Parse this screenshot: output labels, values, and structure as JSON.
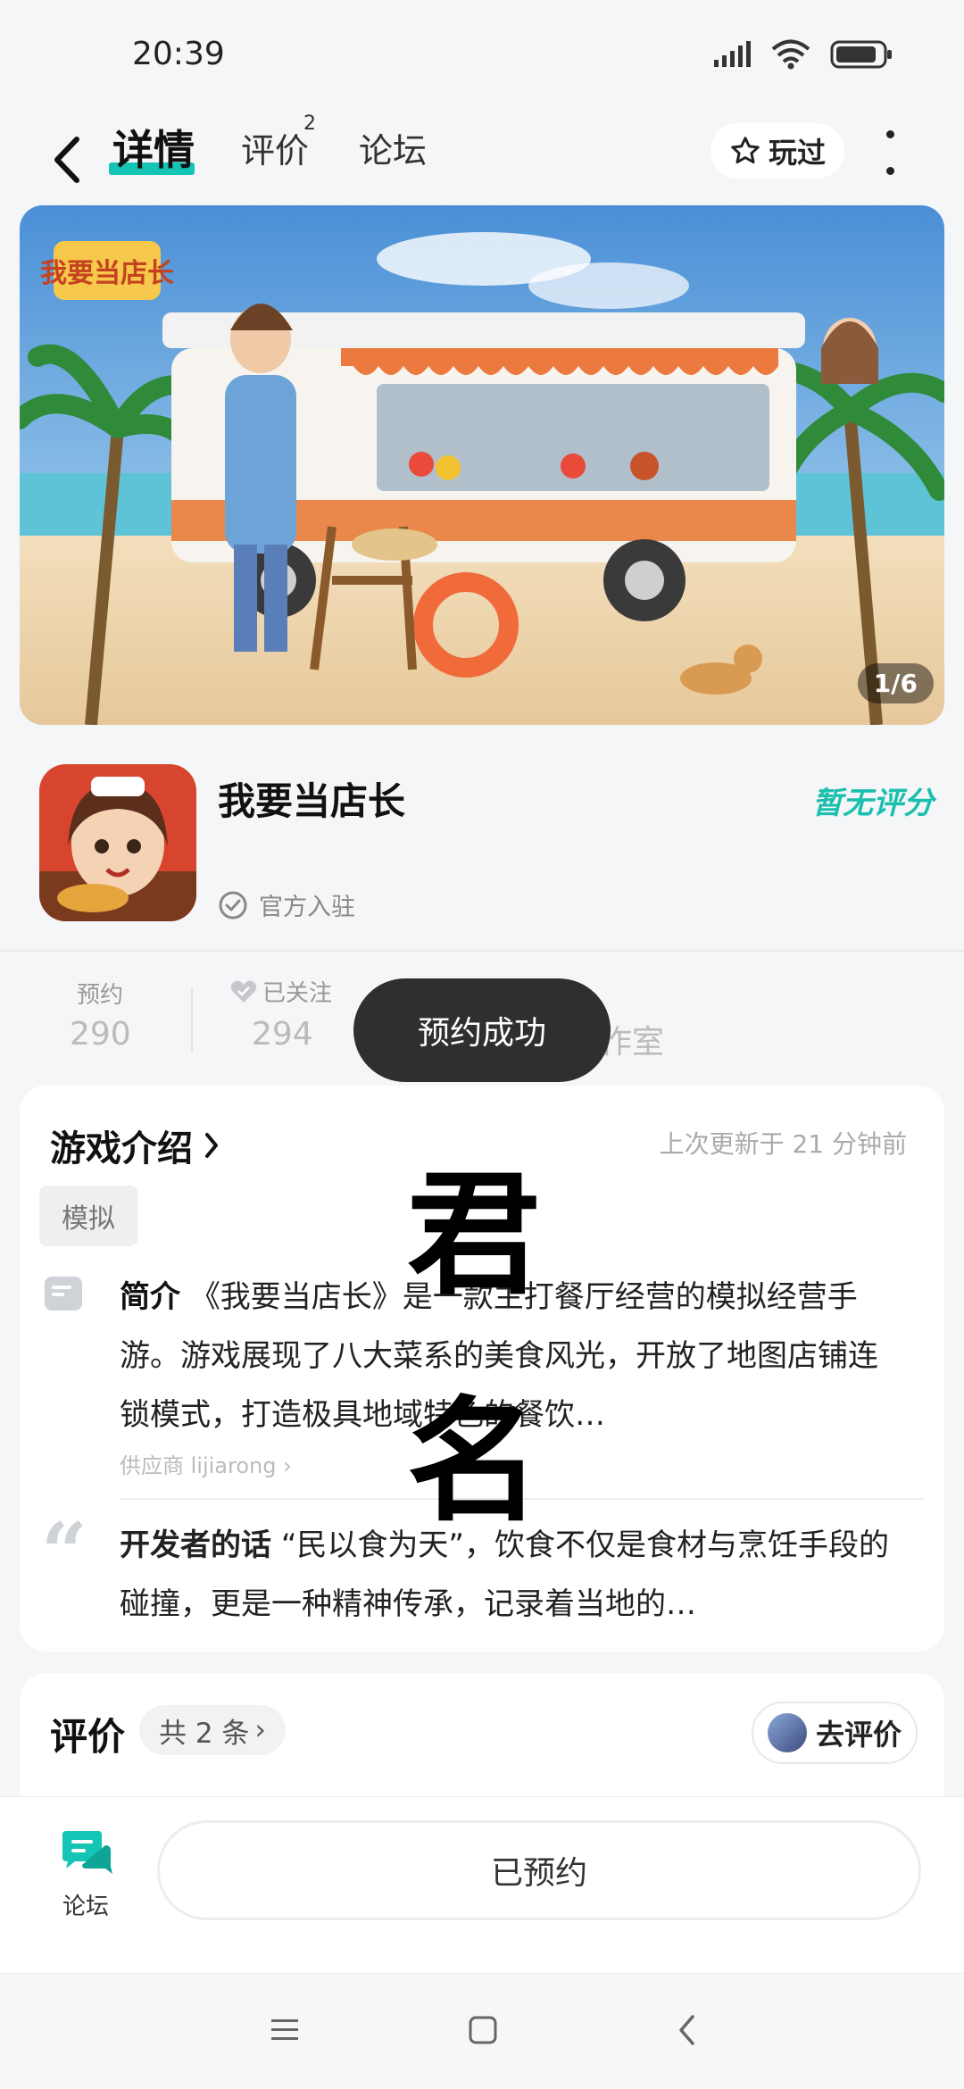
{
  "status": {
    "time": "20:39"
  },
  "nav": {
    "tabs": [
      {
        "label": "详情",
        "active": true
      },
      {
        "label": "评价",
        "badge": "2"
      },
      {
        "label": "论坛"
      }
    ],
    "played_label": "玩过"
  },
  "banner": {
    "counter": "1/6",
    "logo_text": "我要当店长"
  },
  "app": {
    "name": "我要当店长",
    "official_label": "官方入驻",
    "rating_label": "暂无评分"
  },
  "stats": [
    {
      "label": "预约",
      "value": "290"
    },
    {
      "label": "已关注",
      "value": "294"
    },
    {
      "label": "",
      "value": "作室"
    }
  ],
  "toast": "预约成功",
  "intro": {
    "title": "游戏介绍",
    "updated": "上次更新于 21 分钟前",
    "tag": "模拟",
    "desc_title": "简介",
    "desc": "《我要当店长》是一款主打餐厅经营的模拟经营手游。游戏展现了八大菜系的美食风光，开放了地图店铺连锁模式，打造极具地域特色的餐饮…",
    "supplier": "供应商 lijiarong",
    "dev_title": "开发者的话",
    "dev_text": "“民以食为天”，饮食不仅是食材与烹饪手段的碰撞，更是一种精神传承，记录着当地的…"
  },
  "watermark": {
    "line1": "君",
    "line2": "名"
  },
  "reviews": {
    "title": "评价",
    "count": "共 2 条",
    "go_review": "去评价"
  },
  "bottom": {
    "forum_label": "论坛",
    "reserved_label": "已预约"
  },
  "colors": {
    "accent": "#14c4b4",
    "toast_bg": "#2f2f2f"
  }
}
